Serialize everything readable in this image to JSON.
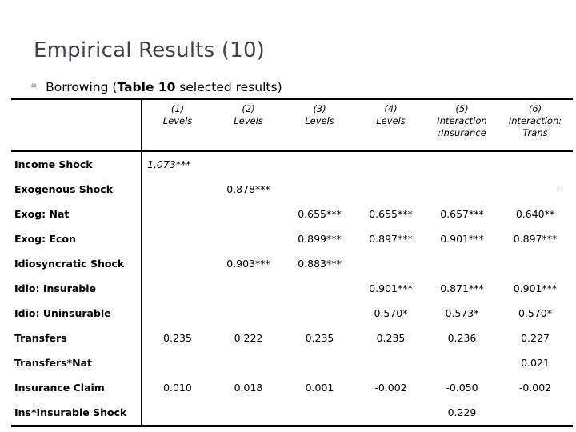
{
  "slide": {
    "title": "Empirical Results (10)",
    "bullet": {
      "glyph": "❝",
      "prefix": "Borrowing (",
      "strong": "Table 10",
      "suffix": " selected results)"
    }
  },
  "table": {
    "label_header": "",
    "columns": [
      {
        "num": "(1)",
        "sub": "Levels"
      },
      {
        "num": "(2)",
        "sub": "Levels"
      },
      {
        "num": "(3)",
        "sub": "Levels"
      },
      {
        "num": "(4)",
        "sub": "Levels"
      },
      {
        "num": "(5)",
        "sub": "Interaction :Insurance"
      },
      {
        "num": "(6)",
        "sub": "Interaction: Trans"
      }
    ],
    "rows": [
      {
        "label": "Income Shock",
        "values": [
          "1.073***",
          "",
          "",
          "",
          "",
          ""
        ]
      },
      {
        "label": "Exogenous Shock",
        "values": [
          "",
          "0.878***",
          "",
          "",
          "",
          "-"
        ]
      },
      {
        "label": "Exog: Nat",
        "values": [
          "",
          "",
          "0.655***",
          "0.655***",
          "0.657***",
          "0.640**"
        ]
      },
      {
        "label": "Exog: Econ",
        "values": [
          "",
          "",
          "0.899***",
          "0.897***",
          "0.901***",
          "0.897***"
        ]
      },
      {
        "label": "Idiosyncratic Shock",
        "values": [
          "",
          "0.903***",
          "0.883***",
          "",
          "",
          ""
        ]
      },
      {
        "label": "Idio: Insurable",
        "values": [
          "",
          "",
          "",
          "0.901***",
          "0.871***",
          "0.901***"
        ]
      },
      {
        "label": "Idio: Uninsurable",
        "values": [
          "",
          "",
          "",
          "0.570*",
          "0.573*",
          "0.570*"
        ]
      },
      {
        "label": "Transfers",
        "values": [
          "0.235",
          "0.222",
          "0.235",
          "0.235",
          "0.236",
          "0.227"
        ]
      },
      {
        "label": "Transfers*Nat",
        "values": [
          "",
          "",
          "",
          "",
          "",
          "0.021"
        ]
      },
      {
        "label": "Insurance Claim",
        "values": [
          "0.010",
          "0.018",
          "0.001",
          "-0.002",
          "-0.050",
          "-0.002"
        ]
      },
      {
        "label": "Ins*Insurable Shock",
        "values": [
          "",
          "",
          "",
          "",
          "0.229",
          ""
        ]
      }
    ]
  }
}
